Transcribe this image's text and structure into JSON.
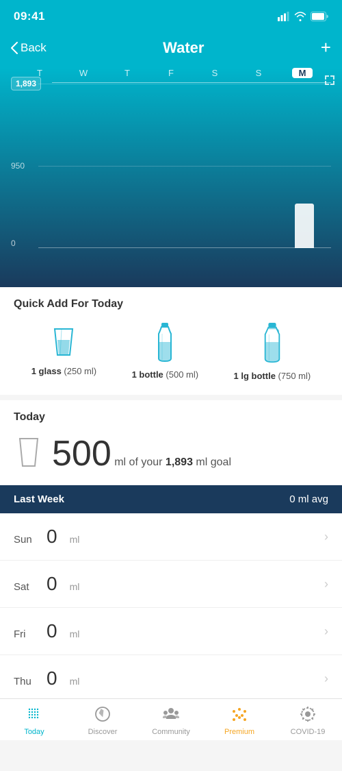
{
  "statusBar": {
    "time": "09:41"
  },
  "header": {
    "backLabel": "Back",
    "title": "Water",
    "addIcon": "+"
  },
  "chart": {
    "days": [
      "T",
      "W",
      "T",
      "F",
      "S",
      "S",
      "M"
    ],
    "activeDay": "M",
    "yLabels": {
      "top": "1,893",
      "mid": "950",
      "bottom": "0"
    },
    "goalValue": "1,893",
    "barHeights": [
      0,
      0,
      0,
      0,
      0,
      0,
      26
    ]
  },
  "quickAdd": {
    "title": "Quick Add For Today",
    "items": [
      {
        "bold": "1 glass",
        "normal": " (250 ml)"
      },
      {
        "bold": "1 bottle",
        "normal": " (500 ml)"
      },
      {
        "bold": "1 lg bottle",
        "normal": " (750 ml)"
      }
    ]
  },
  "today": {
    "label": "Today",
    "amount": "500",
    "description": "ml of your",
    "goal": "1,893",
    "unit": "ml goal"
  },
  "lastWeek": {
    "title": "Last Week",
    "avg": "0 ml avg"
  },
  "days": [
    {
      "name": "Sun",
      "amount": "0",
      "unit": "ml"
    },
    {
      "name": "Sat",
      "amount": "0",
      "unit": "ml"
    },
    {
      "name": "Fri",
      "amount": "0",
      "unit": "ml"
    },
    {
      "name": "Thu",
      "amount": "0",
      "unit": "ml"
    }
  ],
  "tabBar": {
    "items": [
      {
        "id": "today",
        "label": "Today",
        "active": true
      },
      {
        "id": "discover",
        "label": "Discover",
        "active": false
      },
      {
        "id": "community",
        "label": "Community",
        "active": false
      },
      {
        "id": "premium",
        "label": "Premium",
        "active": false,
        "isPremium": true
      },
      {
        "id": "covid",
        "label": "COVID-19",
        "active": false
      }
    ]
  }
}
